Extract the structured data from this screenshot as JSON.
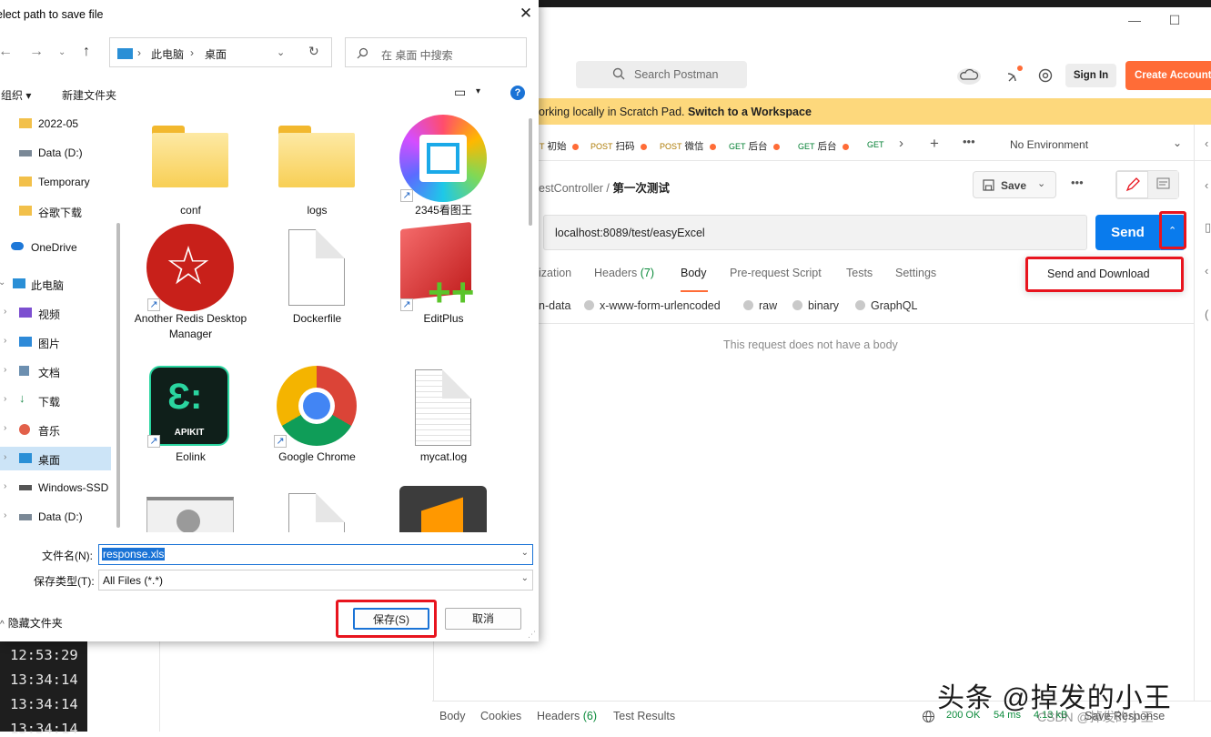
{
  "postman": {
    "search_placeholder": "Search Postman",
    "sign_in": "Sign In",
    "create_account": "Create Account",
    "banner_text": "orking locally in Scratch Pad.",
    "banner_link": "Switch to a Workspace",
    "tabs": [
      {
        "method": "T",
        "name": "初始"
      },
      {
        "method": "POST",
        "name": "扫码"
      },
      {
        "method": "POST",
        "name": "微信"
      },
      {
        "method": "GET",
        "name": "后台"
      },
      {
        "method": "GET",
        "name": "后台"
      },
      {
        "method": "GET",
        "name": ""
      }
    ],
    "environment": "No Environment",
    "breadcrumb_parent": "estController",
    "breadcrumb_sep": "/",
    "breadcrumb_current": "第一次测试",
    "save": "Save",
    "url": "localhost:8089/test/easyExcel",
    "send": "Send",
    "send_menu_item": "Send and Download",
    "request_tabs": [
      "ization",
      "Headers",
      "(7)",
      "Body",
      "Pre-request Script",
      "Tests",
      "Settings"
    ],
    "body_types": [
      "n-data",
      "x-www-form-urlencoded",
      "raw",
      "binary",
      "GraphQL"
    ],
    "no_body": "This request does not have a body",
    "bottom_tabs": [
      "Body",
      "Cookies",
      "Headers",
      "(6)",
      "Test Results"
    ],
    "status": "200 OK",
    "time": "54 ms",
    "size": "4.13 kB",
    "save_response": "Save Response",
    "console_times": [
      "12:53:29",
      "13:34:14",
      "13:34:14",
      "13:34:14"
    ],
    "watermark": "头条 @掉发的小王",
    "watermark2": "CSDN @掉发的小王"
  },
  "dialog": {
    "title": "elect path to save file",
    "path": [
      "此电脑",
      "›",
      "桌面"
    ],
    "search_placeholder": "在 桌面 中搜索",
    "organize": "组织 ▾",
    "new_folder": "新建文件夹",
    "nav_items": [
      "2022-05",
      "Data (D:)",
      "Temporary",
      "谷歌下载",
      "OneDrive",
      "此电脑",
      "视频",
      "图片",
      "文档",
      "下载",
      "音乐",
      "桌面",
      "Windows-SSD",
      "Data (D:)"
    ],
    "files": [
      {
        "name": "conf"
      },
      {
        "name": "logs"
      },
      {
        "name": "2345看图王"
      },
      {
        "name": "Another Redis Desktop Manager"
      },
      {
        "name": "Dockerfile"
      },
      {
        "name": "EditPlus"
      },
      {
        "name": "Eolink"
      },
      {
        "name": "Google Chrome"
      },
      {
        "name": "mycat.log"
      }
    ],
    "eolink_badge": "APIKIT",
    "filename_label": "文件名(N):",
    "filename_value": "response.xls",
    "filetype_label": "保存类型(T):",
    "filetype_value": "All Files (*.*)",
    "hide_folders": "隐藏文件夹",
    "save_button": "保存(S)",
    "cancel_button": "取消"
  },
  "colors": {
    "accent_orange": "#ff6c37",
    "send_blue": "#097bed",
    "banner_yellow": "#fdd87c",
    "highlight_red": "#e8141e"
  }
}
